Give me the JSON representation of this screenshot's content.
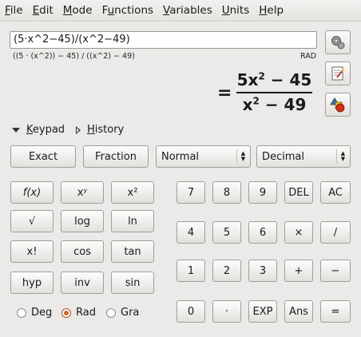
{
  "menu": [
    "File",
    "Edit",
    "Mode",
    "Functions",
    "Variables",
    "Units",
    "Help"
  ],
  "menu_mnemonic": [
    "F",
    "E",
    "M",
    "u",
    "V",
    "U",
    "H"
  ],
  "expression": "(5·x^2−45)/(x^2−49)",
  "parsed_expression": "((5 · (x^2)) − 45) / ((x^2) − 49)",
  "angle_mode_indicator": "RAD",
  "result": {
    "equals": "=",
    "numerator_coef": "5x",
    "numerator_exp": "2",
    "numerator_rest": " − 45",
    "denominator_base": "x",
    "denominator_exp": "2",
    "denominator_rest": " − 49"
  },
  "expanders": {
    "keypad": "Keypad",
    "history": "History"
  },
  "top_buttons": {
    "exact": "Exact",
    "fraction": "Fraction"
  },
  "combos": {
    "display_mode": "Normal",
    "number_base": "Decimal"
  },
  "function_keys": [
    [
      "f(x)",
      "xʸ",
      "x²"
    ],
    [
      "√",
      "log",
      "ln"
    ],
    [
      "x!",
      "cos",
      "tan"
    ],
    [
      "hyp",
      "inv",
      "sin"
    ]
  ],
  "number_keys": [
    [
      "7",
      "8",
      "9",
      "DEL",
      "AC"
    ],
    [
      "4",
      "5",
      "6",
      "×",
      "/"
    ],
    [
      "1",
      "2",
      "3",
      "+",
      "−"
    ],
    [
      "0",
      "·",
      "EXP",
      "Ans",
      "="
    ]
  ],
  "angle_options": [
    {
      "label": "Deg",
      "selected": false
    },
    {
      "label": "Rad",
      "selected": true
    },
    {
      "label": "Gra",
      "selected": false
    }
  ],
  "side_icons": [
    "preferences-icon",
    "edit-notes-icon",
    "shapes-icon"
  ]
}
